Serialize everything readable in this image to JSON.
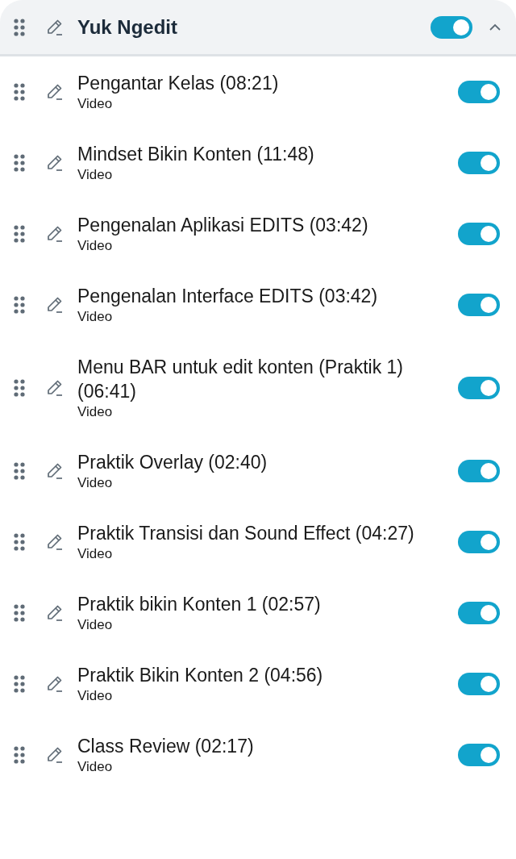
{
  "section": {
    "title": "Yuk Ngedit",
    "on": true,
    "expanded": true
  },
  "items": [
    {
      "title": "Pengantar Kelas (08:21)",
      "type": "Video",
      "on": true
    },
    {
      "title": "Mindset Bikin Konten (11:48)",
      "type": "Video",
      "on": true
    },
    {
      "title": "Pengenalan Aplikasi EDITS (03:42)",
      "type": "Video",
      "on": true
    },
    {
      "title": "Pengenalan Interface EDITS (03:42)",
      "type": "Video",
      "on": true
    },
    {
      "title": "Menu BAR untuk edit konten (Praktik 1) (06:41)",
      "type": "Video",
      "on": true
    },
    {
      "title": "Praktik Overlay (02:40)",
      "type": "Video",
      "on": true
    },
    {
      "title": "Praktik Transisi dan Sound Effect (04:27)",
      "type": "Video",
      "on": true
    },
    {
      "title": "Praktik bikin Konten 1 (02:57)",
      "type": "Video",
      "on": true
    },
    {
      "title": "Praktik Bikin Konten 2 (04:56)",
      "type": "Video",
      "on": true
    },
    {
      "title": "Class Review (02:17)",
      "type": "Video",
      "on": true
    }
  ]
}
